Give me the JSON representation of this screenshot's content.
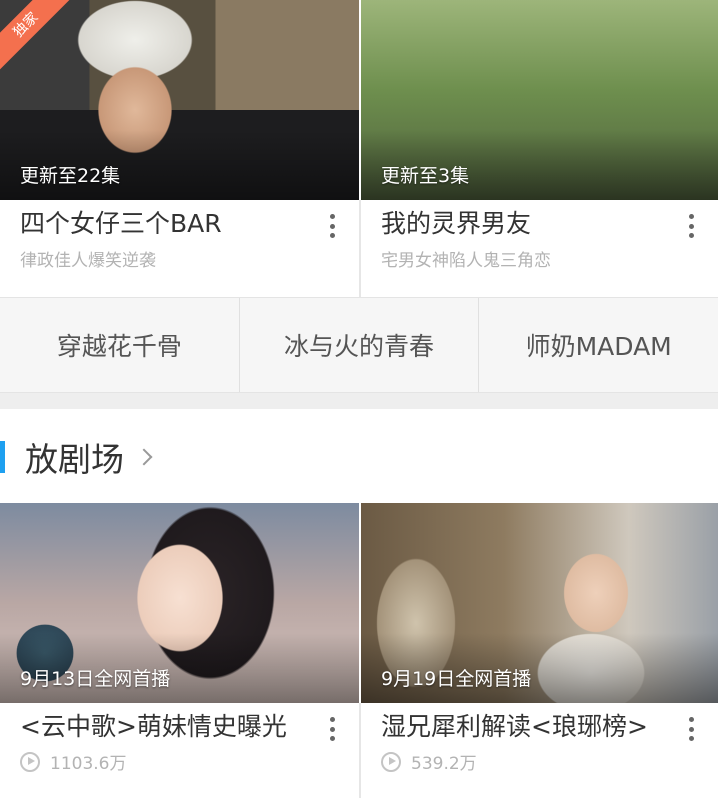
{
  "top_cards": [
    {
      "badge": "独家",
      "caption": "更新至22集",
      "title": "四个女仔三个BAR",
      "subtitle": "律政佳人爆笑逆袭"
    },
    {
      "caption": "更新至3集",
      "title": "我的灵界男友",
      "subtitle": "宅男女神陷人鬼三角恋"
    }
  ],
  "hot_tags": [
    "穿越花千骨",
    "冰与火的青春",
    "师奶MADAM"
  ],
  "section": {
    "title": "放剧场"
  },
  "bottom_cards": [
    {
      "caption": "9月13日全网首播",
      "title": "<云中歌>萌妹情史曝光",
      "plays": "1103.6万"
    },
    {
      "caption": "9月19日全网首播",
      "title": "湿兄犀利解读<琅琊榜>",
      "plays": "539.2万"
    }
  ],
  "colors": {
    "accent": "#1ea0f0",
    "badge": "#f4704e"
  }
}
